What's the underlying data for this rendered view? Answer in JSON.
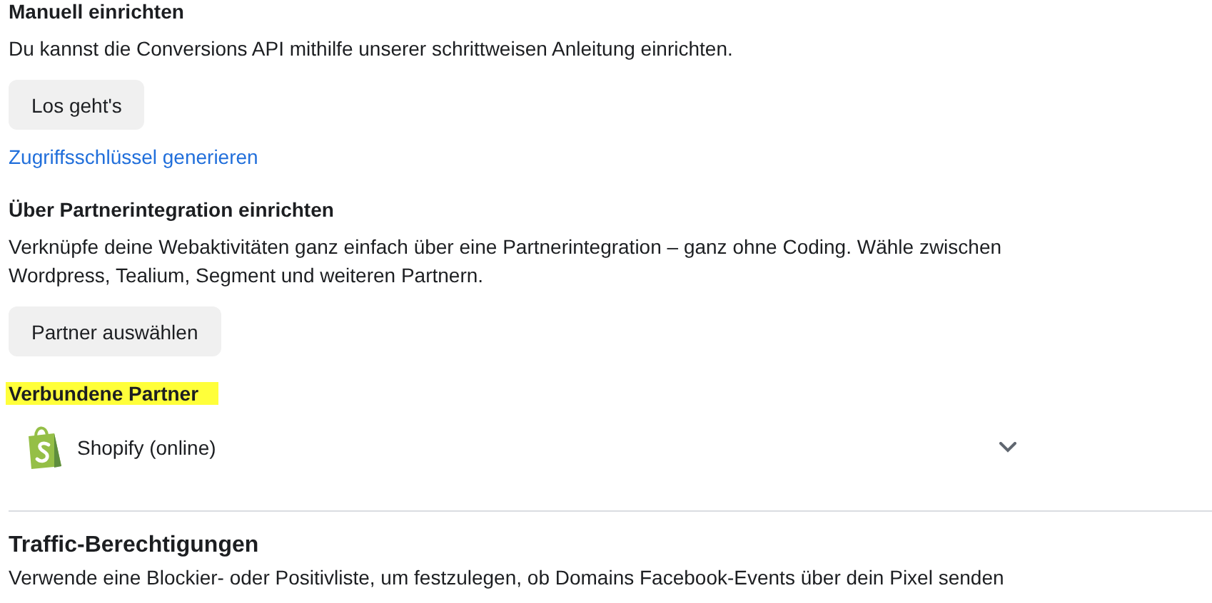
{
  "sections": [
    {
      "heading": "Manuell einrichten",
      "description": "Du kannst die Conversions API mithilfe unserer schrittweisen Anleitung einrichten.",
      "button": "Los geht's",
      "link": "Zugriffsschlüssel generieren"
    },
    {
      "heading": "Über Partnerintegration einrichten",
      "description": "Verknüpfe deine Webaktivitäten ganz einfach über eine Partnerintegration – ganz ohne Coding. Wähle zwischen Wordpress, Tealium, Segment und weiteren Partnern.",
      "button": "Partner auswählen"
    }
  ],
  "connected_partners": {
    "heading": "Verbundene Partner",
    "highlighted": true,
    "items": [
      {
        "name": "Shopify (online)",
        "expanded": false
      }
    ]
  },
  "traffic": {
    "heading": "Traffic-Berechtigungen",
    "description": "Verwende eine Blockier- oder Positivliste, um festzulegen, ob Domains Facebook-Events über dein Pixel senden"
  }
}
